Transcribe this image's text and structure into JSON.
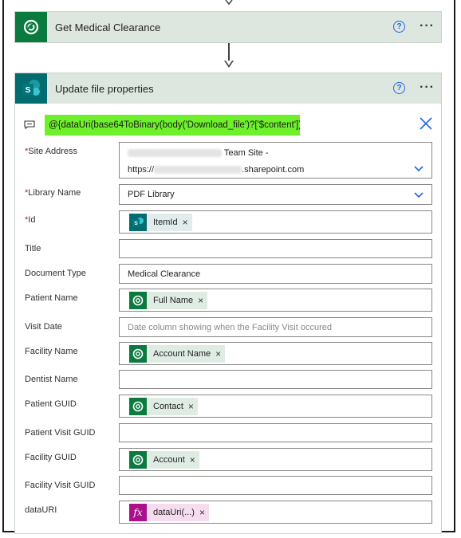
{
  "colors": {
    "accent_blue": "#2266e3",
    "header_bg": "#dde7e0",
    "expression_highlight": "#6ef02a",
    "dataverse_green": "#0b7a3e",
    "sharepoint_teal": "#036c70",
    "expression_pink": "#ad0e8b",
    "required_red": "#a4262c"
  },
  "step1": {
    "title": "Get Medical Clearance",
    "icon": "dataverse-icon"
  },
  "step2": {
    "title": "Update file properties",
    "icon": "sharepoint-icon"
  },
  "expression": "@{dataUri(base64ToBinary(body('Download_file')?['$content']))}",
  "fields": {
    "site_address": {
      "label": "Site Address",
      "line1_suffix": "Team Site -",
      "line2_prefix": "https://",
      "line2_suffix": ".sharepoint.com"
    },
    "library_name": {
      "label": "Library Name",
      "value": "PDF Library"
    },
    "id": {
      "label": "Id",
      "token": "ItemId"
    },
    "title": {
      "label": "Title",
      "value": ""
    },
    "document_type": {
      "label": "Document Type",
      "value": "Medical Clearance"
    },
    "patient_name": {
      "label": "Patient Name",
      "token": "Full Name"
    },
    "visit_date": {
      "label": "Visit Date",
      "placeholder": "Date column showing when the Facility Visit occured"
    },
    "facility_name": {
      "label": "Facility Name",
      "token": "Account Name"
    },
    "dentist_name": {
      "label": "Dentist Name",
      "value": ""
    },
    "patient_guid": {
      "label": "Patient GUID",
      "token": "Contact"
    },
    "patient_visit_guid": {
      "label": "Patient Visit GUID",
      "value": ""
    },
    "facility_guid": {
      "label": "Facility GUID",
      "token": "Account"
    },
    "facility_visit_guid": {
      "label": "Facility Visit GUID",
      "value": ""
    },
    "datauri": {
      "label": "dataURI",
      "token": "dataUri(...)",
      "token_icon": "fx"
    }
  },
  "glyphs": {
    "required": "*",
    "remove": "×",
    "help": "?",
    "more": "···"
  }
}
